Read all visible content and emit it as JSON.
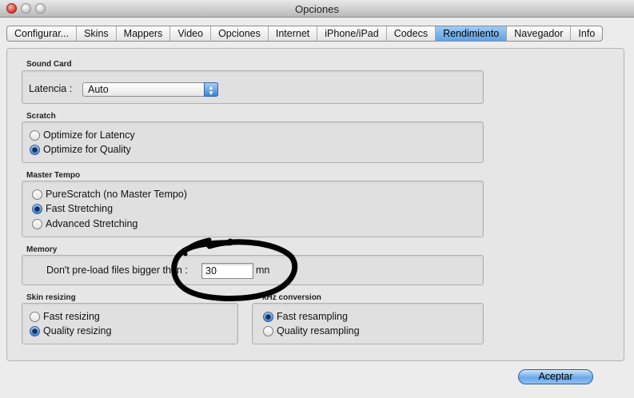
{
  "window": {
    "title": "Opciones"
  },
  "tabs": [
    {
      "label": "Configurar..."
    },
    {
      "label": "Skins"
    },
    {
      "label": "Mappers"
    },
    {
      "label": "Video"
    },
    {
      "label": "Opciones"
    },
    {
      "label": "Internet"
    },
    {
      "label": "iPhone/iPad"
    },
    {
      "label": "Codecs"
    },
    {
      "label": "Rendimiento",
      "selected": true
    },
    {
      "label": "Navegador"
    },
    {
      "label": "Info"
    }
  ],
  "sound_card": {
    "title": "Sound Card",
    "latency_label": "Latencia :",
    "latency_value": "Auto"
  },
  "scratch": {
    "title": "Scratch",
    "options": [
      {
        "label": "Optimize for Latency",
        "selected": false
      },
      {
        "label": "Optimize for Quality",
        "selected": true
      }
    ]
  },
  "master_tempo": {
    "title": "Master Tempo",
    "options": [
      {
        "label": "PureScratch (no Master Tempo)",
        "selected": false
      },
      {
        "label": "Fast Stretching",
        "selected": true
      },
      {
        "label": "Advanced Stretching",
        "selected": false
      }
    ]
  },
  "memory": {
    "title": "Memory",
    "label": "Don't pre-load files bigger than :",
    "value": "30",
    "unit": "mn"
  },
  "skin_resizing": {
    "title": "Skin resizing",
    "options": [
      {
        "label": "Fast resizing",
        "selected": false
      },
      {
        "label": "Quality resizing",
        "selected": true
      }
    ]
  },
  "conversion": {
    "title": "kHz conversion",
    "options": [
      {
        "label": "Fast resampling",
        "selected": true
      },
      {
        "label": "Quality resampling",
        "selected": false
      }
    ]
  },
  "buttons": {
    "accept": "Aceptar"
  },
  "colors": {
    "selected_tab": "#5fa1e6",
    "annotation": "#000000"
  }
}
